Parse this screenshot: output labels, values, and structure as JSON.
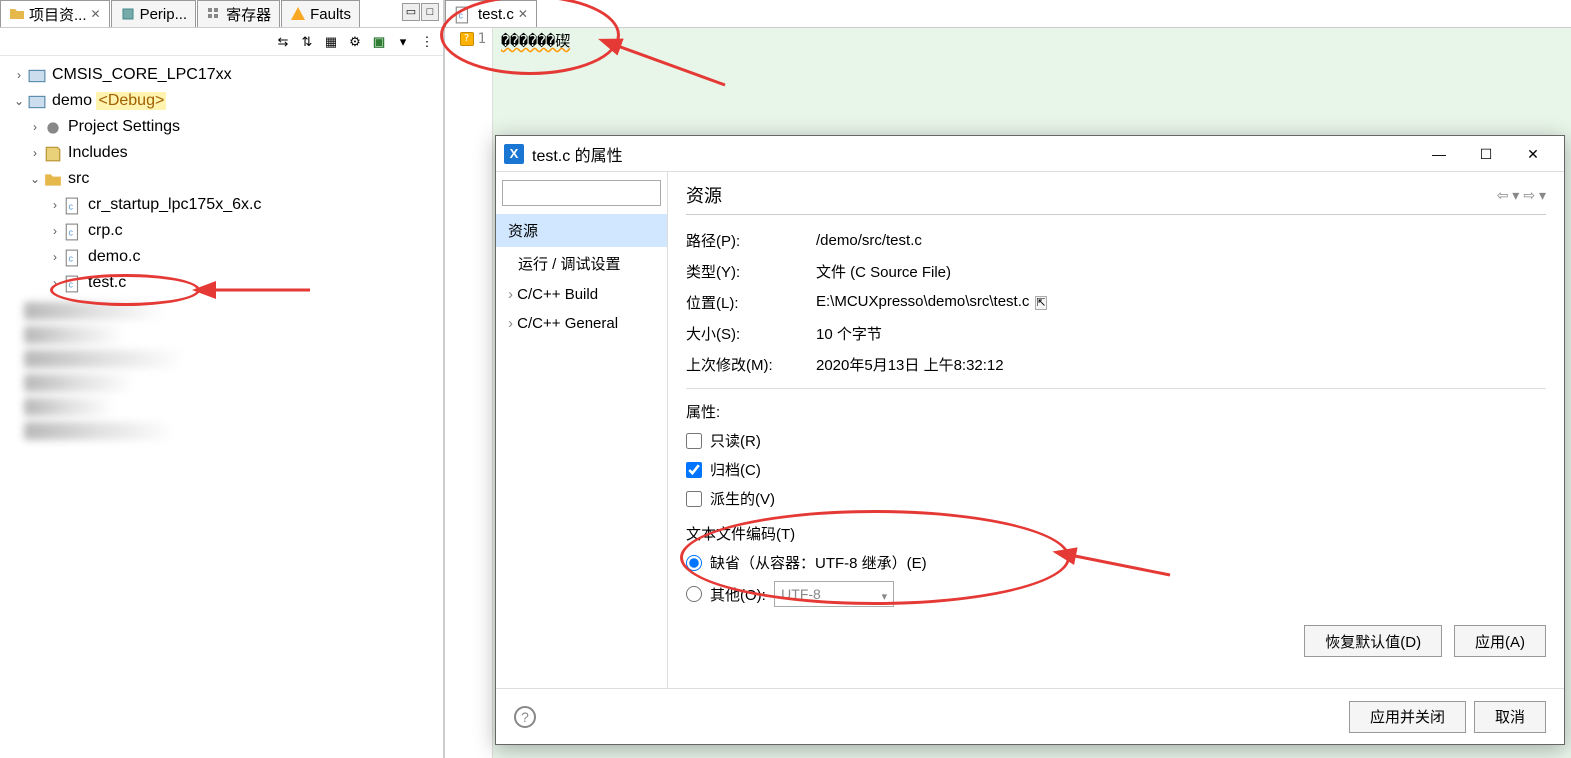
{
  "left": {
    "tabs": [
      {
        "label": "项目资...",
        "active": true
      },
      {
        "label": "Perip..."
      },
      {
        "label": "寄存器"
      },
      {
        "label": "Faults"
      }
    ],
    "tree": {
      "cmsis": "CMSIS_CORE_LPC17xx",
      "demo": "demo",
      "debug_tag": "<Debug>",
      "project_settings": "Project Settings",
      "includes": "Includes",
      "src": "src",
      "files": {
        "cr_startup": "cr_startup_lpc175x_6x.c",
        "crp": "crp.c",
        "demo_c": "demo.c",
        "test": "test.c"
      }
    }
  },
  "editor": {
    "tab_label": "test.c",
    "line_num": "1",
    "code": "������碶"
  },
  "dialog": {
    "title": "test.c 的属性",
    "nav": {
      "resource": "资源",
      "run_debug": "运行 / 调试设置",
      "cpp_build": "C/C++ Build",
      "cpp_general": "C/C++ General"
    },
    "section_title": "资源",
    "props": {
      "path_label": "路径(P):",
      "path_value": "/demo/src/test.c",
      "type_label": "类型(Y):",
      "type_value": "文件 (C Source File)",
      "location_label": "位置(L):",
      "location_value": "E:\\MCUXpresso\\demo\\src\\test.c",
      "size_label": "大小(S):",
      "size_value": "10 个字节",
      "modified_label": "上次修改(M):",
      "modified_value": "2020年5月13日 上午8:32:12"
    },
    "attrs": {
      "group": "属性:",
      "readonly": "只读(R)",
      "archive": "归档(C)",
      "derived": "派生的(V)"
    },
    "encoding": {
      "group": "文本文件编码(T)",
      "default": "缺省（从容器：UTF-8 继承）(E)",
      "other": "其他(O):",
      "other_value": "UTF-8"
    },
    "buttons": {
      "restore": "恢复默认值(D)",
      "apply": "应用(A)",
      "apply_close": "应用并关闭",
      "cancel": "取消"
    }
  }
}
